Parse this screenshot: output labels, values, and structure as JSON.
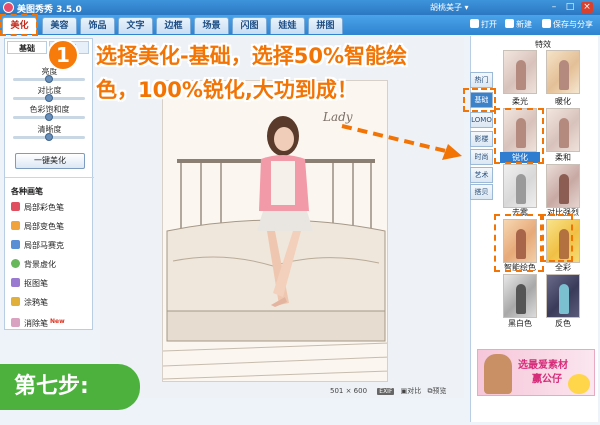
{
  "window": {
    "title": "美图秀秀 3.5.0",
    "user": "胡桃美子 ▾"
  },
  "toolbar": {
    "tabs": [
      "美化",
      "美容",
      "饰品",
      "文字",
      "边框",
      "场景",
      "闪图",
      "娃娃",
      "拼图"
    ],
    "open_label": "打开",
    "new_label": "新建",
    "save_label": "保存与分享"
  },
  "left_panel": {
    "subtabs": [
      "基础",
      "高级"
    ],
    "sliders": [
      {
        "label": "亮度",
        "value": 0.5
      },
      {
        "label": "对比度",
        "value": 0.5
      },
      {
        "label": "色彩饱和度",
        "value": 0.5
      },
      {
        "label": "清晰度",
        "value": 0.5
      }
    ],
    "one_key_label": "一键美化",
    "brushes_title": "各种画笔",
    "brushes": [
      {
        "label": "局部彩色笔",
        "color": "#e04f5f"
      },
      {
        "label": "局部变色笔",
        "color": "#f2a23a"
      },
      {
        "label": "局部马赛克",
        "color": "#5a8fd6"
      },
      {
        "label": "背景虚化",
        "color": "#67b85a"
      },
      {
        "label": "抠图笔",
        "color": "#9a7ad0"
      },
      {
        "label": "涂鸦笔",
        "color": "#e0b03a"
      },
      {
        "label": "消除笔",
        "color": "#d9a2c0",
        "tag": "New"
      }
    ]
  },
  "canvas": {
    "dimensions": "501 × 600",
    "compare_label": "对比",
    "preview_label": "预览",
    "exif_label": "EXIF"
  },
  "right_panel": {
    "title": "特效",
    "categories": [
      "热门",
      "基础",
      "LOMO",
      "影楼",
      "时尚",
      "艺术",
      "搭贝"
    ],
    "active_category": "基础",
    "thumbs": [
      {
        "label": "柔光"
      },
      {
        "label": "暖化"
      },
      {
        "label": "锐化",
        "selected": true
      },
      {
        "label": "柔和"
      },
      {
        "label": "去雾"
      },
      {
        "label": "对比强烈"
      },
      {
        "label": "智能绘色"
      },
      {
        "label": "全彩"
      },
      {
        "label": "黑白色"
      },
      {
        "label": "反色"
      }
    ],
    "ad": {
      "line1": "选最爱素材",
      "line2": "赢公仔"
    }
  },
  "overlay": {
    "step_number": "1",
    "line1": "选择美化-基础，选择50%智能绘",
    "line2": "色，100%锐化,大功到成！",
    "step_badge": "第七步:"
  },
  "colors": {
    "accent_orange": "#f27405",
    "title_blue": "#2b77c2",
    "step_green": "#4cb23d"
  }
}
